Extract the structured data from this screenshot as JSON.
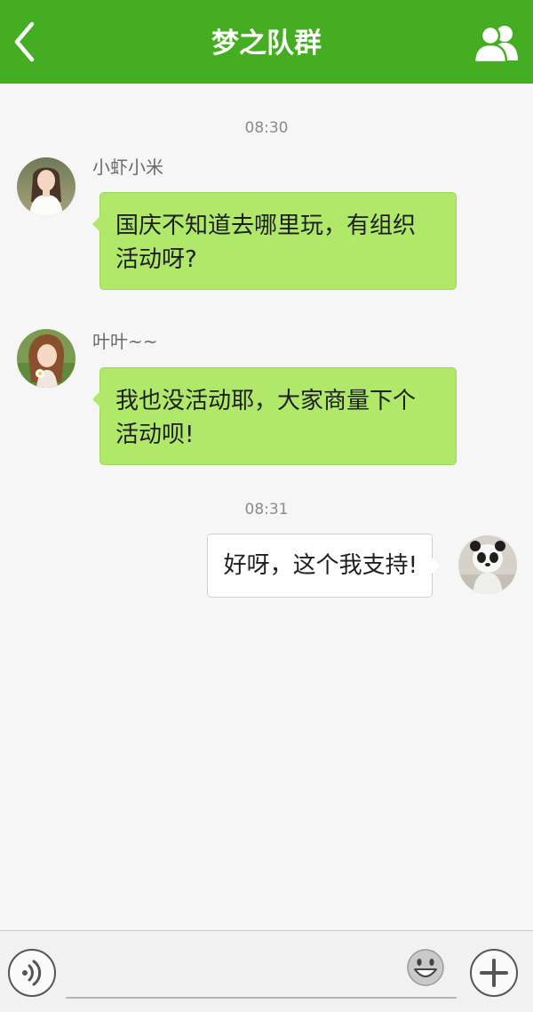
{
  "header": {
    "title": "梦之队群",
    "back_icon": "chevron-left-icon",
    "members_icon": "group-members-icon",
    "bg_color": "#44ad22"
  },
  "messages": [
    {
      "type": "time",
      "text": "08:30"
    },
    {
      "type": "incoming",
      "sender": "小虾小米",
      "text_lines": [
        "国庆不知道去哪里玩，有组织",
        "活动呀?"
      ]
    },
    {
      "type": "incoming",
      "sender": "叶叶~~",
      "text_lines": [
        "我也没活动耶，大家商量下个",
        "活动呗!"
      ]
    },
    {
      "type": "time",
      "text": "08:31"
    },
    {
      "type": "outgoing",
      "text": "好呀，这个我支持!"
    }
  ],
  "input_bar": {
    "voice_icon": "voice-icon",
    "emoji_icon": "emoji-icon",
    "plus_icon": "plus-icon",
    "input_value": "",
    "placeholder": ""
  },
  "colors": {
    "incoming_bubble": "#b0e86a",
    "outgoing_bubble": "#ffffff",
    "background": "#f6f6f6"
  }
}
